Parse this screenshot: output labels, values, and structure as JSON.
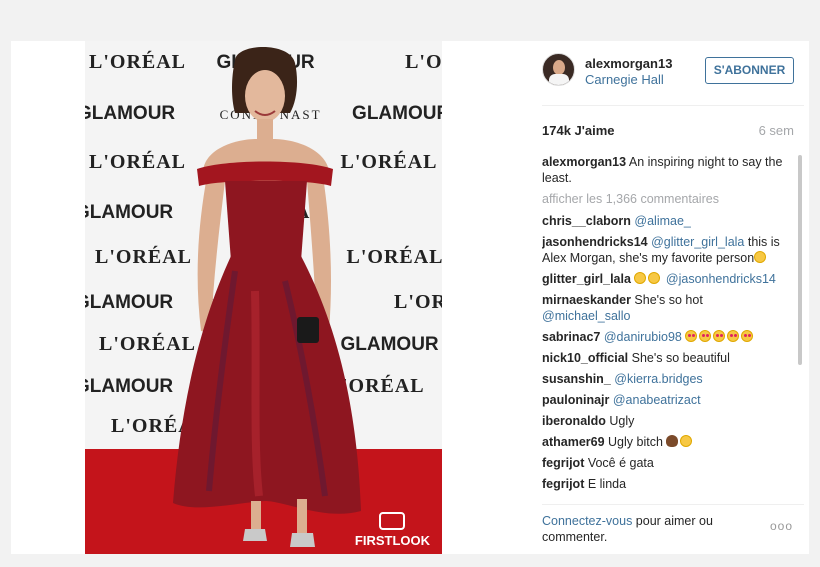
{
  "post": {
    "username": "alexmorgan13",
    "location": "Carnegie Hall",
    "follow_label": "S'ABONNER",
    "likes": "174k J'aime",
    "time_ago": "6 sem",
    "view_all_comments": "afficher les 1,366 commentaires",
    "login_link": "Connectez-vous",
    "login_text": " pour aimer ou commenter.",
    "options_icon": "more-options-icon",
    "options_glyph": "ooo"
  },
  "photo": {
    "watermark": "FIRSTLOOK",
    "backdrop_brands": [
      "L'ORÉAL",
      "GLAMOUR",
      "CONDÉ NAST"
    ]
  },
  "caption": {
    "user": "alexmorgan13",
    "text": " An inspiring night to say the least."
  },
  "comments": [
    {
      "user": "chris__claborn",
      "mention": " @alimae_",
      "text": "",
      "emoji": []
    },
    {
      "user": "jasonhendricks14",
      "mention": " @glitter_girl_lala",
      "text": " this is Alex Morgan, she's my favorite person",
      "emoji": [
        "laugh"
      ]
    },
    {
      "user": "glitter_girl_lala",
      "mention": " @jasonhendricks14",
      "text": "",
      "emoji_before": [
        "laugh",
        "laugh"
      ]
    },
    {
      "user": "mirnaeskander",
      "text": " She's so hot ",
      "mention": "@michael_sallo",
      "emoji": []
    },
    {
      "user": "sabrinac7",
      "mention": " @danirubio98",
      "text": " ",
      "emoji": [
        "heart-eyes",
        "heart-eyes",
        "heart-eyes",
        "heart-eyes",
        "heart-eyes"
      ]
    },
    {
      "user": "nick10_official",
      "text": " She's so beautiful",
      "mention": "",
      "emoji": []
    },
    {
      "user": "susanshin_",
      "mention": " @kierra.bridges",
      "text": "",
      "emoji": []
    },
    {
      "user": "pauloninajr",
      "mention": " @anabeatrizact",
      "text": "",
      "emoji": []
    },
    {
      "user": "iberonaldo",
      "text": " Ugly",
      "mention": "",
      "emoji": []
    },
    {
      "user": "athamer69",
      "text": " Ugly bitch ",
      "mention": "",
      "emoji": [
        "poo",
        "flushed"
      ]
    },
    {
      "user": "fegrijot",
      "text": " Você é gata",
      "mention": "",
      "emoji": []
    },
    {
      "user": "fegrijot",
      "text": " E linda",
      "mention": "",
      "emoji": []
    }
  ],
  "colors": {
    "link": "#3f729b",
    "muted": "#a5a7aa",
    "carpet": "#c4141b",
    "dress": "#8e1620"
  }
}
